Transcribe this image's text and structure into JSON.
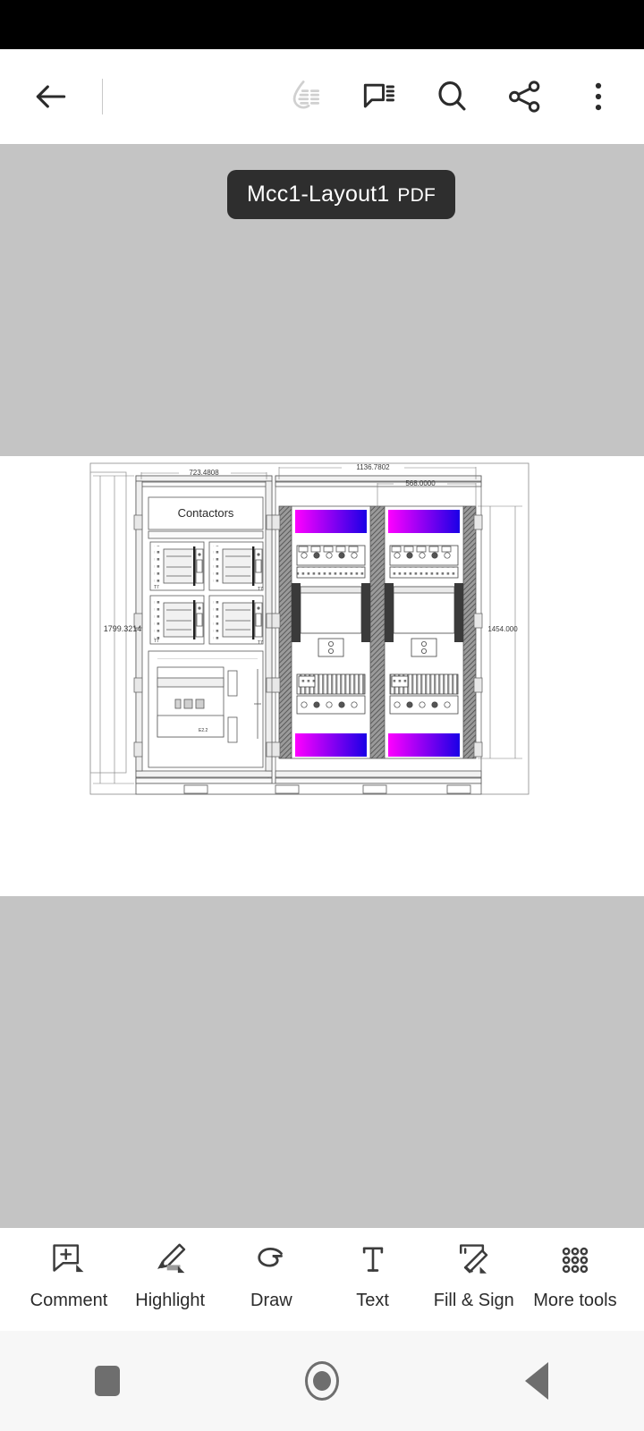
{
  "app": {
    "document_title": "Mcc1-Layout1",
    "document_ext": "PDF"
  },
  "topbar": {
    "back_label": "back-arrow",
    "actions": [
      {
        "name": "liquid-mode",
        "label": "Liquid Mode",
        "state": "disabled"
      },
      {
        "name": "comment",
        "label": "Comment"
      },
      {
        "name": "search",
        "label": "Search"
      },
      {
        "name": "share",
        "label": "Share"
      },
      {
        "name": "more",
        "label": "More options"
      }
    ]
  },
  "toolbar": {
    "tools": [
      {
        "label": "Comment",
        "icon": "comment-add-icon"
      },
      {
        "label": "Highlight",
        "icon": "highlighter-icon"
      },
      {
        "label": "Draw",
        "icon": "draw-loop-icon"
      },
      {
        "label": "Text",
        "icon": "text-icon"
      },
      {
        "label": "Fill & Sign",
        "icon": "fill-sign-icon"
      },
      {
        "label": "More tools",
        "icon": "grid-dots-icon"
      }
    ]
  },
  "navbar": {
    "recents": "recents-button",
    "home": "home-button",
    "back": "back-button"
  },
  "drawing": {
    "panel_label": "Contactors",
    "dimensions": {
      "top_left": "723.4808",
      "top_right": "1136.7802",
      "inner_right": "568.0000",
      "left_height": "1799.3214",
      "right_height": "1454.000"
    },
    "device_labels": {
      "contactor_1": "T7",
      "contactor_2": "T7",
      "contactor_3": "T7",
      "contactor_4": "T7",
      "breaker": "E2.2"
    },
    "colors": {
      "gradient_start": "#ff00ff",
      "gradient_end": "#1a00e6",
      "hatch": "#555555",
      "line": "#3a3a3a"
    }
  }
}
